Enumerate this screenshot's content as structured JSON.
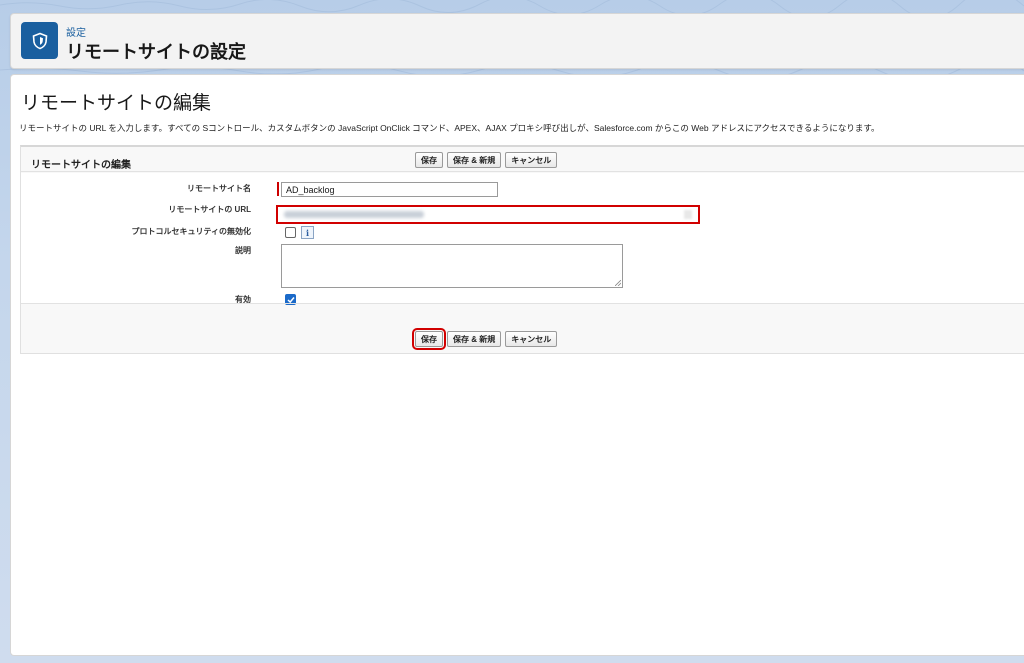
{
  "header": {
    "eyebrow": "設定",
    "title": "リモートサイトの設定",
    "icon": "setup-shield-icon"
  },
  "page": {
    "title": "リモートサイトの編集",
    "description": "リモートサイトの URL を入力します。すべての Sコントロール、カスタムボタンの JavaScript OnClick コマンド、APEX、AJAX プロキシ呼び出しが、Salesforce.com からこの Web アドレスにアクセスできるようになります。"
  },
  "panel": {
    "title": "リモートサイトの編集",
    "buttons": {
      "save": "保存",
      "save_new": "保存 & 新規",
      "cancel": "キャンセル"
    }
  },
  "form": {
    "remote_site_name": {
      "label": "リモートサイト名",
      "value": "AD_backlog"
    },
    "remote_site_url": {
      "label": "リモートサイトの URL",
      "value": ""
    },
    "disable_protocol_security": {
      "label": "プロトコルセキュリティの無効化",
      "checked": false,
      "info_icon": "info-icon"
    },
    "description": {
      "label": "説明",
      "value": ""
    },
    "active": {
      "label": "有効",
      "checked": true
    }
  },
  "colors": {
    "brand": "#1a5f9f",
    "highlight": "#d10000",
    "checkbox": "#1b6ac9"
  }
}
